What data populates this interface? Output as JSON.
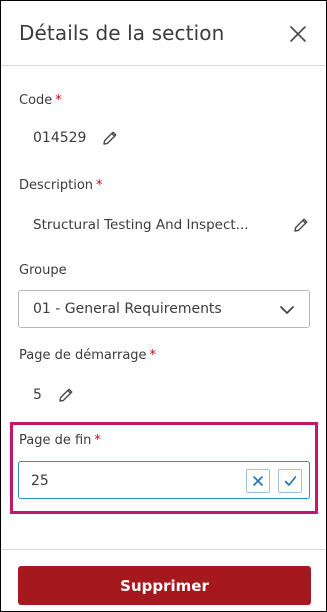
{
  "header": {
    "title": "Détails de la section",
    "close_icon": "close-icon"
  },
  "fields": {
    "code": {
      "label": "Code",
      "required_mark": "*",
      "value": "014529",
      "edit_icon": "pencil-icon"
    },
    "description": {
      "label": "Description",
      "required_mark": "*",
      "value": "Structural Testing And Inspect...",
      "edit_icon": "pencil-icon"
    },
    "group": {
      "label": "Groupe",
      "selected": "01 - General Requirements",
      "chevron_icon": "chevron-down-icon"
    },
    "start_page": {
      "label": "Page de démarrage",
      "required_mark": "*",
      "value": "5",
      "edit_icon": "pencil-icon"
    },
    "end_page": {
      "label": "Page de fin",
      "required_mark": "*",
      "value": "25",
      "cancel_icon": "x-icon",
      "confirm_icon": "check-icon"
    }
  },
  "footer": {
    "delete_label": "Supprimer"
  },
  "colors": {
    "required": "#d0021b",
    "highlight": "#c2186b",
    "input_focus": "#2b8fd8",
    "delete_bg": "#a5191e"
  }
}
